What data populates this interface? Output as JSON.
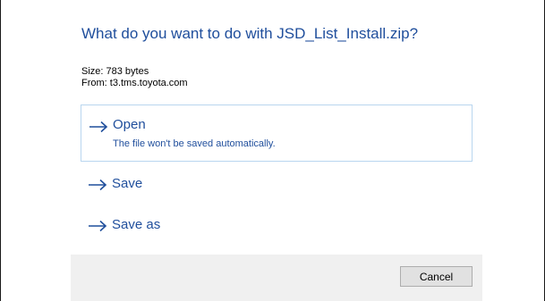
{
  "dialog": {
    "title": "What do you want to do with JSD_List_Install.zip?",
    "size_text": "Size: 783 bytes",
    "from_text": "From: t3.tms.toyota.com"
  },
  "options": [
    {
      "label": "Open",
      "description": "The file won't be saved automatically.",
      "icon": "arrow-right-icon"
    },
    {
      "label": "Save",
      "icon": "arrow-right-icon"
    },
    {
      "label": "Save as",
      "icon": "arrow-right-icon"
    }
  ],
  "footer": {
    "cancel_label": "Cancel"
  },
  "colors": {
    "accent": "#1f4e9c",
    "selected_border": "#b9d6ef",
    "footer_bg": "#f0f0f0",
    "button_bg": "#e1e1e1"
  }
}
